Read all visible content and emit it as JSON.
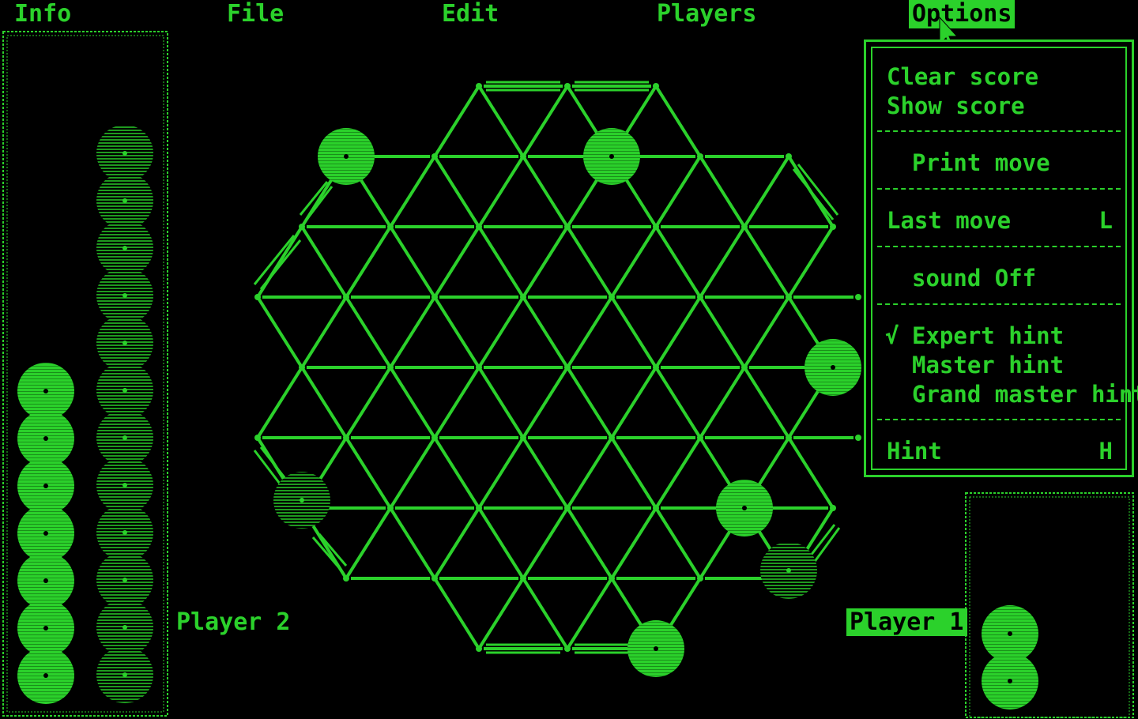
{
  "menu": {
    "info": "Info",
    "file": "File",
    "edit": "Edit",
    "players": "Players",
    "options": "Options"
  },
  "options_menu": {
    "clear_score": "Clear score",
    "show_score": "Show score",
    "print_move": "Print move",
    "last_move": "Last move",
    "last_move_key": "L",
    "sound": "sound Off",
    "check_mark": "√",
    "expert_hint": "Expert hint",
    "master_hint": "Master hint",
    "grand_master_hint": "Grand master hint",
    "hint": "Hint",
    "hint_key": "H"
  },
  "players": {
    "player2": "Player 2",
    "player1": "Player 1"
  },
  "colors": {
    "fg": "#2bd12b",
    "bg": "#000000"
  }
}
